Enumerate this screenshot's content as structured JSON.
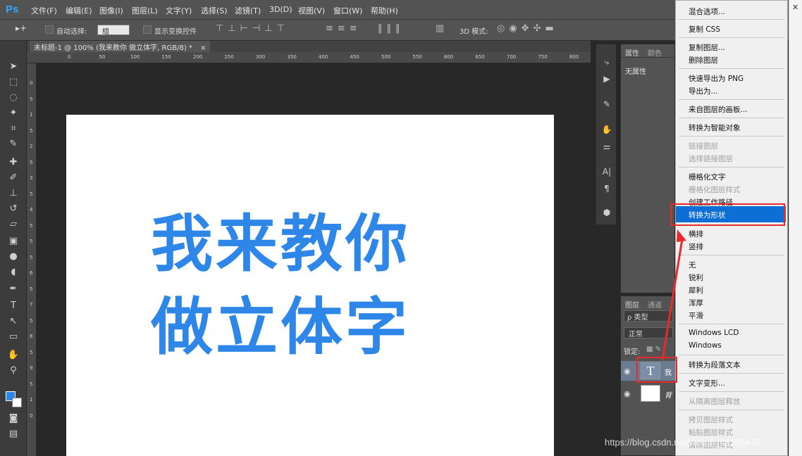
{
  "menubar": {
    "logo": "Ps",
    "items": [
      "文件(F)",
      "编辑(E)",
      "图像(I)",
      "图层(L)",
      "文字(Y)",
      "选择(S)",
      "滤镜(T)",
      "3D(D)",
      "视图(V)",
      "窗口(W)",
      "帮助(H)"
    ]
  },
  "options": {
    "auto_select_label": "自动选择:",
    "group_value": "组",
    "show_transform_label": "显示变换控件",
    "mode_3d_label": "3D 模式:"
  },
  "document": {
    "tab_title": "未标题-1 @ 100% (我来教你 做立体字, RGB/8) *",
    "line1": "我来教你",
    "line2": "做立体字"
  },
  "ruler": {
    "h_ticks": [
      "0",
      "50",
      "100",
      "150",
      "200",
      "250",
      "300",
      "350",
      "400",
      "450",
      "500",
      "550",
      "600",
      "650",
      "700",
      "750",
      "800"
    ],
    "v_ticks": [
      "0",
      "5",
      "1",
      "5",
      "2",
      "5",
      "3",
      "5",
      "4",
      "5",
      "5",
      "5",
      "6",
      "5",
      "7",
      "5",
      "8",
      "5",
      "9",
      "5",
      "1",
      "0"
    ]
  },
  "properties": {
    "tab1": "属性",
    "tab2": "颜色",
    "no_props": "无属性"
  },
  "layers": {
    "tab1": "图层",
    "tab2": "通道",
    "filter_label": "ρ 类型",
    "blend_mode": "正常",
    "lock_label": "锁定:",
    "text_layer_thumb": "T",
    "text_layer_name": "我",
    "bg_layer_name": "背"
  },
  "context_menu": {
    "items": [
      {
        "label": "混合选项...",
        "disabled": false
      },
      {
        "label": "复制 CSS",
        "disabled": false
      },
      {
        "label": "复制图层...",
        "disabled": false
      },
      {
        "label": "删除图层",
        "disabled": false
      },
      {
        "label": "快速导出为 PNG",
        "disabled": false
      },
      {
        "label": "导出为...",
        "disabled": false
      },
      {
        "label": "来自图层的画板...",
        "disabled": false
      },
      {
        "label": "转换为智能对象",
        "disabled": false
      },
      {
        "label": "链接图层",
        "disabled": true
      },
      {
        "label": "选择链接图层",
        "disabled": true
      },
      {
        "label": "栅格化文字",
        "disabled": false
      },
      {
        "label": "栅格化图层样式",
        "disabled": true
      },
      {
        "label": "创建工作路径",
        "disabled": false
      },
      {
        "label": "转换为形状",
        "disabled": false,
        "highlighted": true
      },
      {
        "label": "横排",
        "disabled": false
      },
      {
        "label": "竖排",
        "disabled": false
      },
      {
        "label": "无",
        "disabled": false
      },
      {
        "label": "锐利",
        "disabled": false
      },
      {
        "label": "犀利",
        "disabled": false
      },
      {
        "label": "浑厚",
        "disabled": false
      },
      {
        "label": "平滑",
        "disabled": false
      },
      {
        "label": "Windows LCD",
        "disabled": false
      },
      {
        "label": "Windows",
        "disabled": false
      },
      {
        "label": "转换为段落文本",
        "disabled": false
      },
      {
        "label": "文字变形...",
        "disabled": false
      },
      {
        "label": "从隔离图层释放",
        "disabled": true
      },
      {
        "label": "拷贝图层样式",
        "disabled": true
      },
      {
        "label": "粘贴图层样式",
        "disabled": true
      },
      {
        "label": "清除图层样式",
        "disabled": true
      }
    ]
  },
  "scrollbar": {
    "close_glyph": "✕"
  },
  "watermark": "https://blog.csdn.net/weixin_44535476",
  "colors": {
    "accent_text": "#2d86e8",
    "menu_highlight": "#0d6fd6",
    "annotation": "#e82a2a"
  }
}
